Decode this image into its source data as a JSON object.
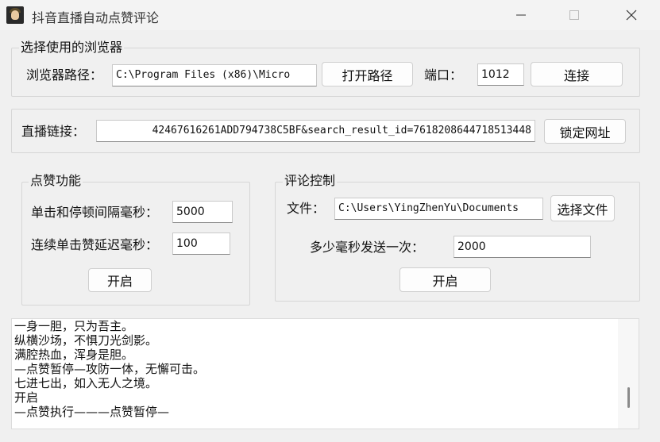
{
  "window": {
    "title": "抖音直播自动点赞评论",
    "controls": [
      "minimize-icon",
      "maximize-icon",
      "close-icon"
    ]
  },
  "browser_group": {
    "legend": "选择使用的浏览器",
    "path_label": "浏览器路径：",
    "path_value": "C:\\Program Files (x86)\\Micro",
    "open_path_button": "打开路径",
    "port_label": "端口：",
    "port_value": "1012",
    "connect_button": "连接"
  },
  "live_link": {
    "label": "直播链接：",
    "value": "42467616261ADD794738C5BF&search_result_id=7618208644718513448",
    "lock_button": "锁定网址"
  },
  "like_group": {
    "legend": "点赞功能",
    "interval_label": "单击和停顿间隔毫秒：",
    "interval_value": "5000",
    "delay_label": "连续单击赞延迟毫秒：",
    "delay_value": "100",
    "start_button": "开启"
  },
  "comment_group": {
    "legend": "评论控制",
    "file_label": "文件：",
    "file_value": "C:\\Users\\YingZhenYu\\Documents",
    "choose_file_button": "选择文件",
    "send_interval_label": "多少毫秒发送一次：",
    "send_interval_value": "2000",
    "start_button": "开启"
  },
  "log": {
    "lines": [
      "一身一胆，只为吾主。",
      "纵横沙场，不惧刀光剑影。",
      "满腔热血，浑身是胆。",
      "—点赞暂停—攻防一体，无懈可击。",
      "七进七出，如入无人之境。",
      "开启",
      "—点赞执行———点赞暂停—"
    ]
  }
}
